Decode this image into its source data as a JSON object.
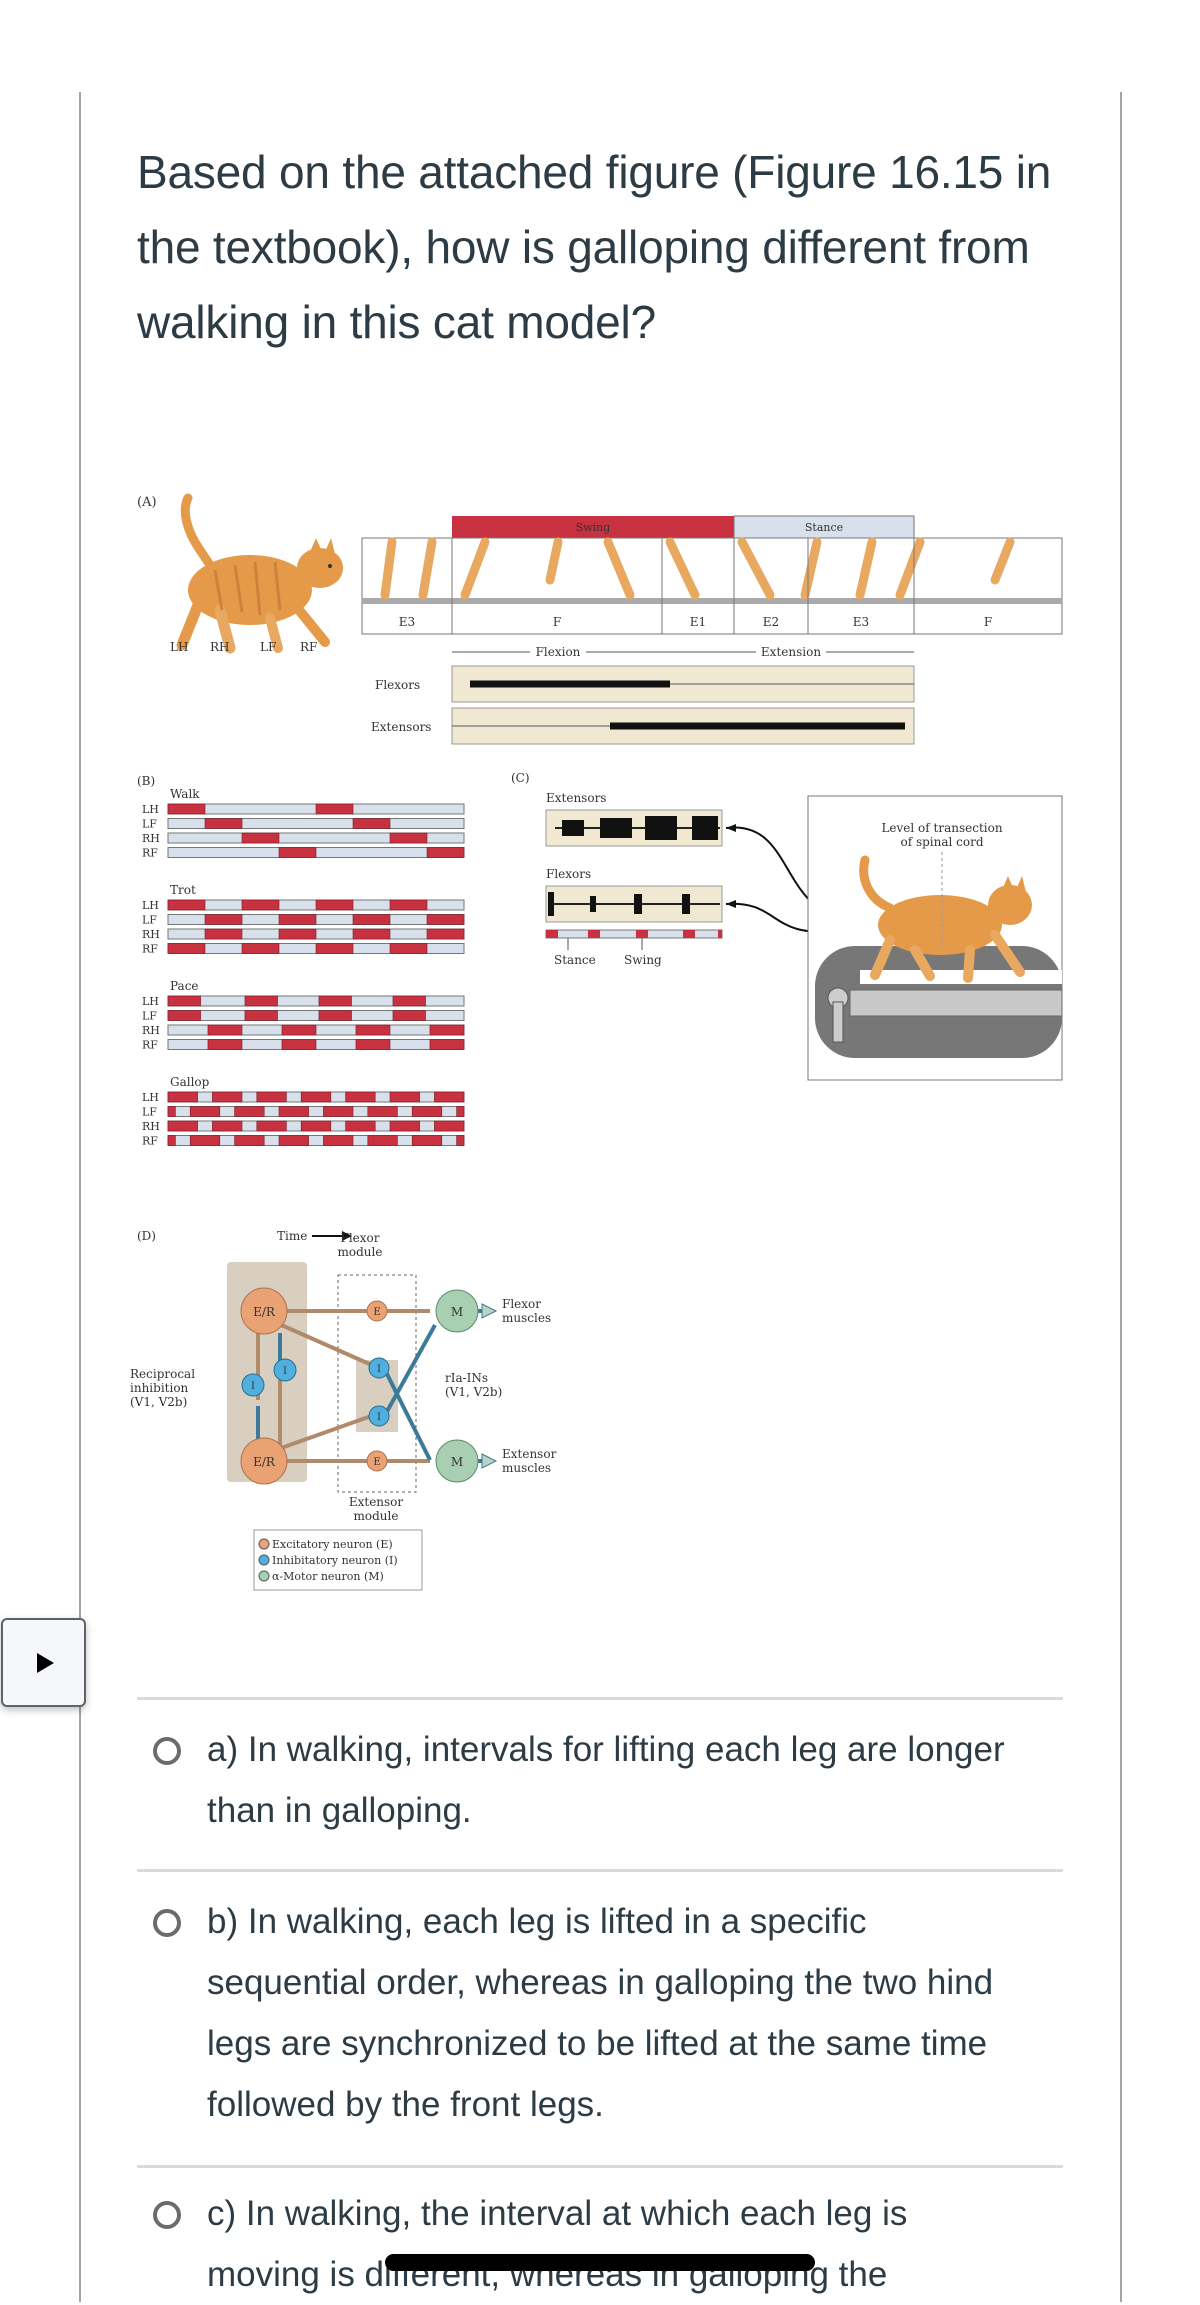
{
  "question": {
    "text": "Based on the attached figure (Figure 16.15 in the textbook), how is galloping different from walking in this cat model?"
  },
  "figure": {
    "panel_a": {
      "label": "(A)",
      "legs": [
        "LH",
        "RH",
        "LF",
        "RF"
      ],
      "swing_label": "Swing",
      "stance_label": "Stance",
      "phases": [
        "E3",
        "F",
        "E1",
        "E2",
        "E3",
        "F"
      ],
      "flexion_label": "Flexion",
      "extension_label": "Extension",
      "emg_rows": [
        "Flexors",
        "Extensors"
      ]
    },
    "panel_b": {
      "label": "(B)",
      "time_label": "Time",
      "gaits": [
        {
          "name": "Walk",
          "rows": [
            {
              "leg": "LH",
              "swing": [
                [
                  0,
                  0.125
                ],
                [
                  0.5,
                  0.625
                ]
              ]
            },
            {
              "leg": "LF",
              "swing": [
                [
                  0.125,
                  0.25
                ],
                [
                  0.625,
                  0.75
                ]
              ]
            },
            {
              "leg": "RH",
              "swing": [
                [
                  0.25,
                  0.375
                ],
                [
                  0.75,
                  0.875
                ]
              ]
            },
            {
              "leg": "RF",
              "swing": [
                [
                  0.375,
                  0.5
                ],
                [
                  0.875,
                  1.0
                ]
              ]
            }
          ]
        },
        {
          "name": "Trot",
          "rows": [
            {
              "leg": "LH",
              "swing": [
                [
                  0,
                  0.125
                ],
                [
                  0.25,
                  0.375
                ],
                [
                  0.5,
                  0.625
                ],
                [
                  0.75,
                  0.875
                ]
              ]
            },
            {
              "leg": "LF",
              "swing": [
                [
                  0.125,
                  0.25
                ],
                [
                  0.375,
                  0.5
                ],
                [
                  0.625,
                  0.75
                ],
                [
                  0.875,
                  1.0
                ]
              ]
            },
            {
              "leg": "RH",
              "swing": [
                [
                  0.125,
                  0.25
                ],
                [
                  0.375,
                  0.5
                ],
                [
                  0.625,
                  0.75
                ],
                [
                  0.875,
                  1.0
                ]
              ]
            },
            {
              "leg": "RF",
              "swing": [
                [
                  0,
                  0.125
                ],
                [
                  0.25,
                  0.375
                ],
                [
                  0.5,
                  0.625
                ],
                [
                  0.75,
                  0.875
                ]
              ]
            }
          ]
        },
        {
          "name": "Pace",
          "rows": [
            {
              "leg": "LH",
              "swing": [
                [
                  0,
                  0.11
                ],
                [
                  0.26,
                  0.37
                ],
                [
                  0.51,
                  0.62
                ],
                [
                  0.76,
                  0.87
                ]
              ]
            },
            {
              "leg": "LF",
              "swing": [
                [
                  0,
                  0.11
                ],
                [
                  0.26,
                  0.37
                ],
                [
                  0.51,
                  0.62
                ],
                [
                  0.76,
                  0.87
                ]
              ]
            },
            {
              "leg": "RH",
              "swing": [
                [
                  0.135,
                  0.25
                ],
                [
                  0.385,
                  0.5
                ],
                [
                  0.635,
                  0.75
                ],
                [
                  0.885,
                  1.0
                ]
              ]
            },
            {
              "leg": "RF",
              "swing": [
                [
                  0.135,
                  0.25
                ],
                [
                  0.385,
                  0.5
                ],
                [
                  0.635,
                  0.75
                ],
                [
                  0.885,
                  1.0
                ]
              ]
            }
          ]
        },
        {
          "name": "Gallop",
          "rows": [
            {
              "leg": "LH",
              "swing": [
                [
                  0,
                  0.1
                ],
                [
                  0.15,
                  0.25
                ],
                [
                  0.3,
                  0.4
                ],
                [
                  0.45,
                  0.55
                ],
                [
                  0.6,
                  0.7
                ],
                [
                  0.75,
                  0.85
                ],
                [
                  0.9,
                  1.0
                ]
              ]
            },
            {
              "leg": "LF",
              "swing": [
                [
                  0,
                  0.025
                ],
                [
                  0.075,
                  0.175
                ],
                [
                  0.225,
                  0.325
                ],
                [
                  0.375,
                  0.475
                ],
                [
                  0.525,
                  0.625
                ],
                [
                  0.675,
                  0.775
                ],
                [
                  0.825,
                  0.925
                ],
                [
                  0.975,
                  1.0
                ]
              ]
            },
            {
              "leg": "RH",
              "swing": [
                [
                  0,
                  0.1
                ],
                [
                  0.15,
                  0.25
                ],
                [
                  0.3,
                  0.4
                ],
                [
                  0.45,
                  0.55
                ],
                [
                  0.6,
                  0.7
                ],
                [
                  0.75,
                  0.85
                ],
                [
                  0.9,
                  1.0
                ]
              ]
            },
            {
              "leg": "RF",
              "swing": [
                [
                  0,
                  0.025
                ],
                [
                  0.075,
                  0.175
                ],
                [
                  0.225,
                  0.325
                ],
                [
                  0.375,
                  0.475
                ],
                [
                  0.525,
                  0.625
                ],
                [
                  0.675,
                  0.775
                ],
                [
                  0.825,
                  0.925
                ],
                [
                  0.975,
                  1.0
                ]
              ]
            }
          ]
        }
      ]
    },
    "panel_c": {
      "label": "(C)",
      "extensors_label": "Extensors",
      "flexors_label": "Flexors",
      "stance_label": "Stance",
      "swing_label": "Swing",
      "transection_label_line1": "Level of transection",
      "transection_label_line2": "of spinal cord"
    },
    "panel_d": {
      "label": "(D)",
      "flexor_module_line1": "Flexor",
      "flexor_module_line2": "module",
      "extensor_module_line1": "Extensor",
      "extensor_module_line2": "module",
      "reciprocal_line1": "Reciprocal",
      "reciprocal_line2": "inhibition",
      "reciprocal_line3": "(V1, V2b)",
      "rla_line1": "rIa-INs",
      "rla_line2": "(V1, V2b)",
      "flexor_muscles_line1": "Flexor",
      "flexor_muscles_line2": "muscles",
      "extensor_muscles_line1": "Extensor",
      "extensor_muscles_line2": "muscles",
      "node_er": "E/R",
      "node_e": "E",
      "node_i": "I",
      "node_m": "M",
      "legend": [
        {
          "label": "Excitatory neuron (E)",
          "color": "#e8a273"
        },
        {
          "label": "Inhibitatory neuron (I)",
          "color": "#4fb0e0"
        },
        {
          "label": "α-Motor neuron (M)",
          "color": "#a9cfb3"
        }
      ]
    },
    "colors": {
      "swing_red": "#c8313f",
      "stance_blue": "#d8e0ec",
      "emg_bg": "#f1e8d2",
      "cat_orange": "#e59a4a"
    }
  },
  "sidebar_toggle": {
    "icon": "play-triangle-icon"
  },
  "options": [
    {
      "id": "a",
      "text": "a) In walking, intervals for lifting each leg are longer than in galloping."
    },
    {
      "id": "b",
      "text": "b) In walking, each leg is lifted in a specific sequential order, whereas in galloping the two hind legs are synchronized to be lifted at the same time followed by the front legs."
    },
    {
      "id": "c",
      "text": "c) In walking, the interval at which each leg is moving is different, whereas in galloping the"
    }
  ]
}
